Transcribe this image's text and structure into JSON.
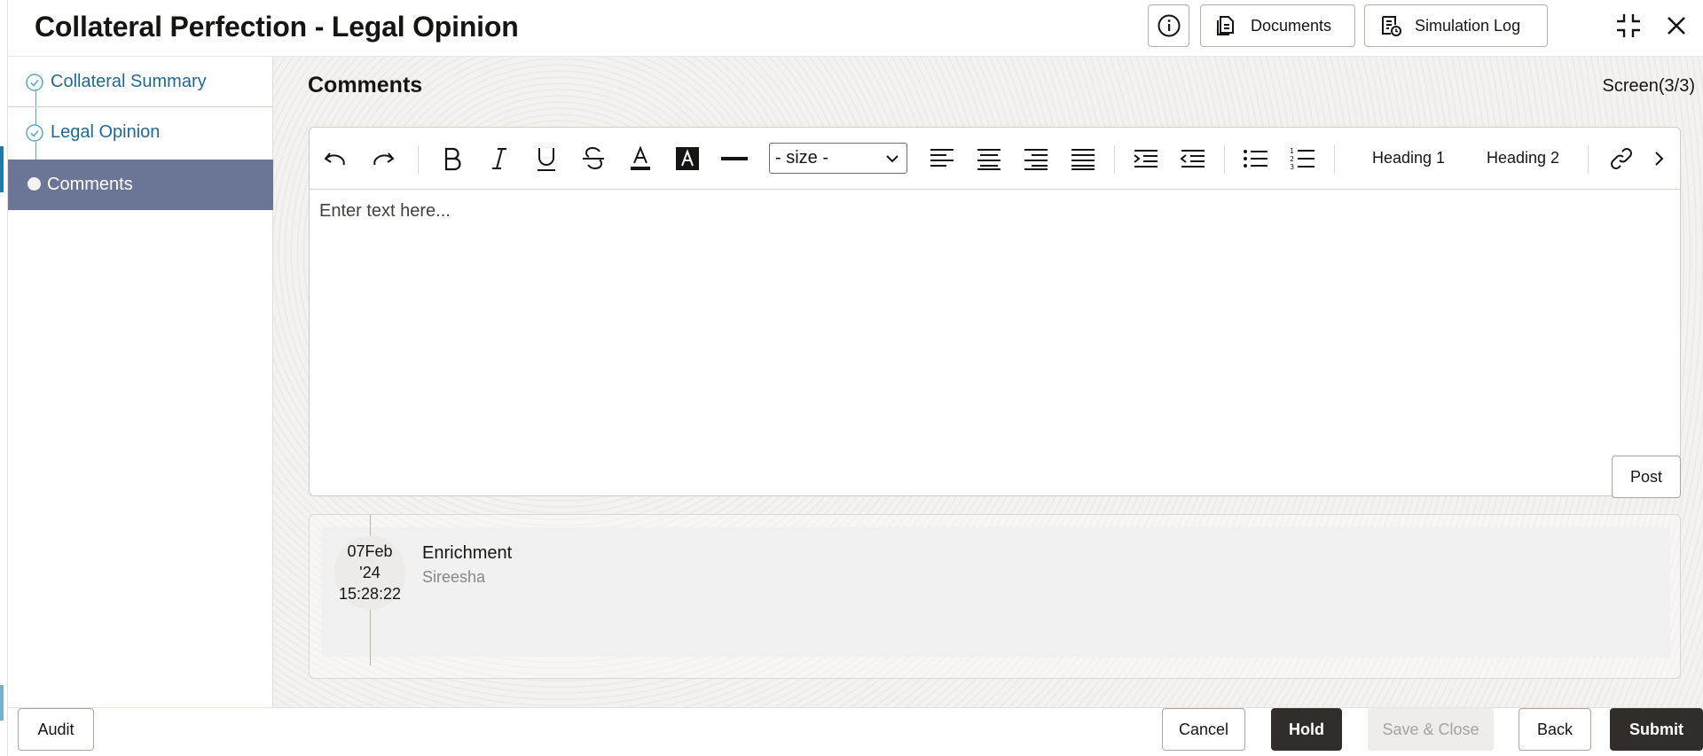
{
  "header": {
    "title": "Collateral Perfection - Legal Opinion",
    "info_icon": "info-icon",
    "documents_label": "Documents",
    "simulation_log_label": "Simulation Log"
  },
  "sidebar": {
    "steps": [
      {
        "label": "Collateral Summary",
        "state": "completed"
      },
      {
        "label": "Legal Opinion",
        "state": "completed"
      },
      {
        "label": "Comments",
        "state": "active"
      }
    ]
  },
  "main": {
    "title": "Comments",
    "screen_indicator": "Screen(3/3)",
    "editor": {
      "size_select_value": "- size -",
      "heading1_label": "Heading 1",
      "heading2_label": "Heading 2",
      "placeholder": "Enter text here..."
    },
    "post_label": "Post",
    "comments": [
      {
        "date_line1": "07Feb",
        "date_line2": "'24",
        "time": "15:28:22",
        "title": "Enrichment",
        "user": "Sireesha"
      }
    ]
  },
  "footer": {
    "audit_label": "Audit",
    "cancel_label": "Cancel",
    "hold_label": "Hold",
    "save_close_label": "Save & Close",
    "back_label": "Back",
    "submit_label": "Submit"
  },
  "colors": {
    "accent": "#1f6a93",
    "active_step_bg": "#6b7696",
    "primary_button": "#312d2a"
  }
}
